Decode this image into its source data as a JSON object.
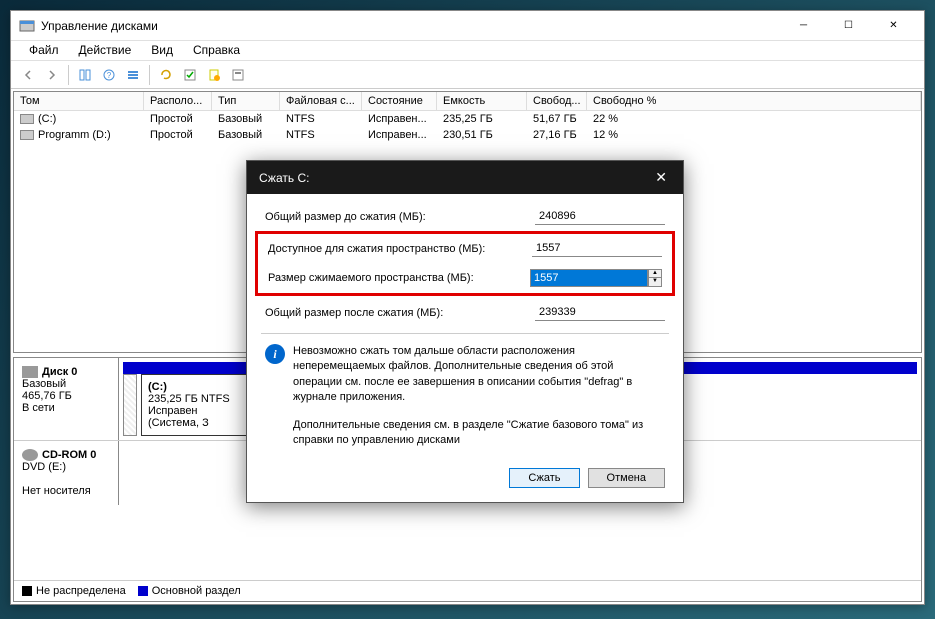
{
  "window": {
    "title": "Управление дисками"
  },
  "menu": {
    "file": "Файл",
    "action": "Действие",
    "view": "Вид",
    "help": "Справка"
  },
  "columns": {
    "volume": "Том",
    "layout": "Располо...",
    "type": "Тип",
    "filesystem": "Файловая с...",
    "status": "Состояние",
    "capacity": "Емкость",
    "free": "Свобод...",
    "freepct": "Свободно %"
  },
  "volumes": [
    {
      "name": "(C:)",
      "layout": "Простой",
      "type": "Базовый",
      "fs": "NTFS",
      "status": "Исправен...",
      "capacity": "235,25 ГБ",
      "free": "51,67 ГБ",
      "pct": "22 %"
    },
    {
      "name": "Programm (D:)",
      "layout": "Простой",
      "type": "Базовый",
      "fs": "NTFS",
      "status": "Исправен...",
      "capacity": "230,51 ГБ",
      "free": "27,16 ГБ",
      "pct": "12 %"
    }
  ],
  "disks": {
    "disk0": {
      "name": "Диск 0",
      "type": "Базовый",
      "size": "465,76 ГБ",
      "status": "В сети"
    },
    "partC": {
      "name": "(C:)",
      "desc": "235,25 ГБ NTFS",
      "status": "Исправен (Система, З"
    },
    "cdrom": {
      "name": "CD-ROM 0",
      "type": "DVD (E:)",
      "status": "Нет носителя"
    }
  },
  "legend": {
    "unalloc": "Не распределена",
    "primary": "Основной раздел"
  },
  "dialog": {
    "title": "Сжать C:",
    "total_before_label": "Общий размер до сжатия (МБ):",
    "total_before_value": "240896",
    "available_label": "Доступное для сжатия пространство (МБ):",
    "available_value": "1557",
    "shrink_label": "Размер сжимаемого пространства (МБ):",
    "shrink_value": "1557",
    "total_after_label": "Общий размер после сжатия (МБ):",
    "total_after_value": "239339",
    "info1": "Невозможно сжать том дальше области расположения неперемещаемых файлов. Дополнительные сведения об этой операции см. после ее завершения в описании события \"defrag\" в журнале приложения.",
    "info2": "Дополнительные сведения см. в разделе \"Сжатие базового тома\" из справки по управлению дисками",
    "btn_shrink": "Сжать",
    "btn_cancel": "Отмена"
  }
}
